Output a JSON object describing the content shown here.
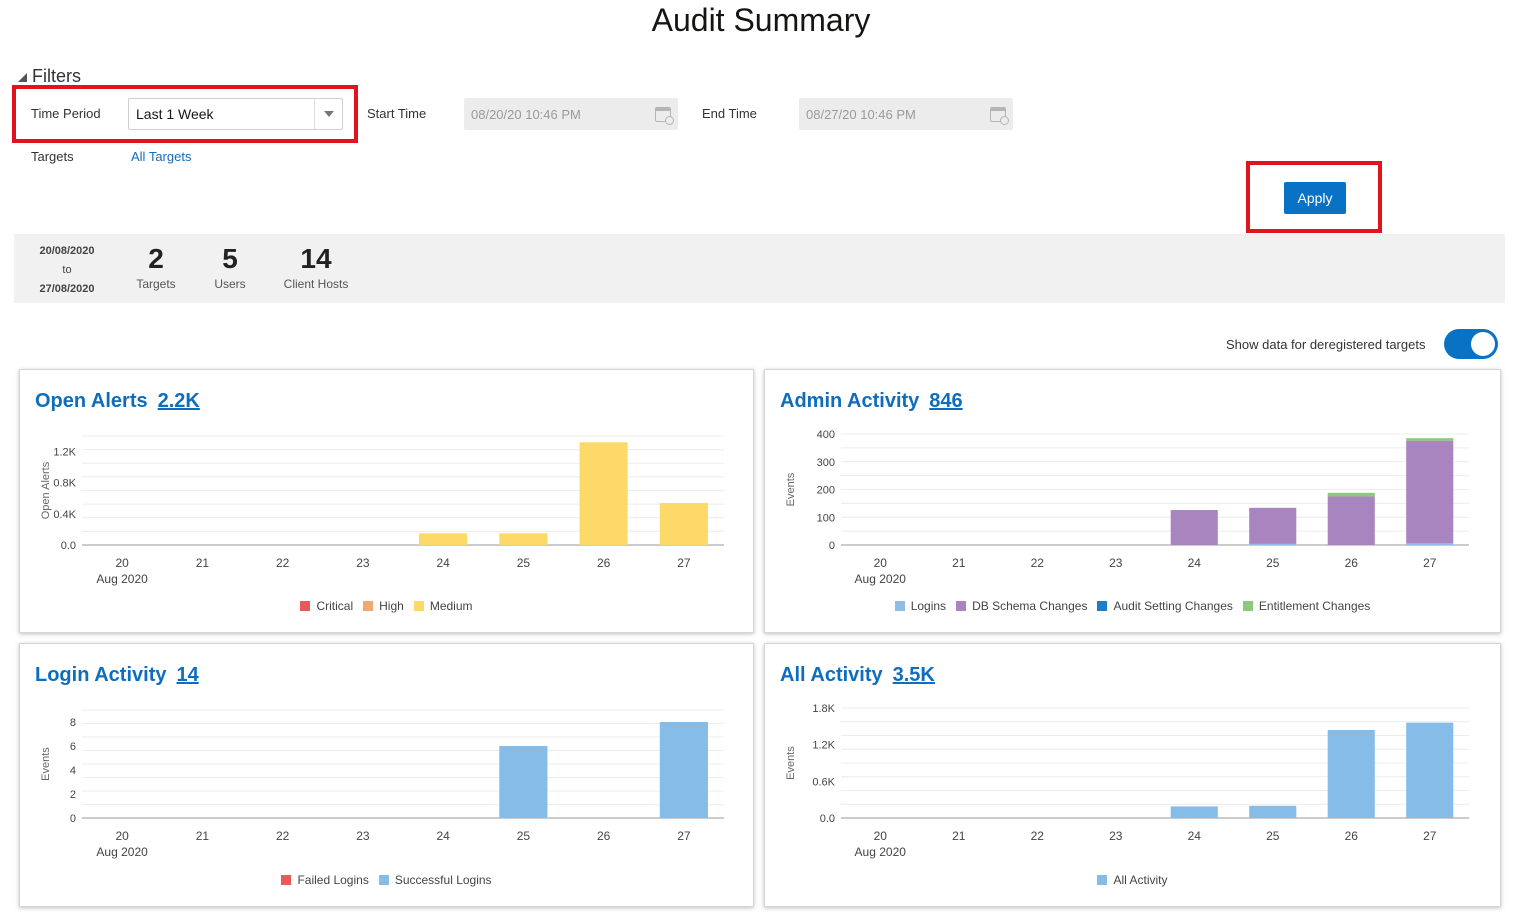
{
  "page_title": "Audit Summary",
  "filters": {
    "toggle_label": "Filters",
    "time_period_label": "Time Period",
    "time_period_value": "Last 1 Week",
    "start_time_label": "Start Time",
    "start_time_value": "08/20/20 10:46 PM",
    "end_time_label": "End Time",
    "end_time_value": "08/27/20 10:46 PM",
    "targets_label": "Targets",
    "targets_value": "All Targets",
    "apply_label": "Apply"
  },
  "summary": {
    "date_from": "20/08/2020",
    "date_to_word": "to",
    "date_to": "27/08/2020",
    "stats": [
      {
        "value": "2",
        "caption": "Targets"
      },
      {
        "value": "5",
        "caption": "Users"
      },
      {
        "value": "14",
        "caption": "Client Hosts"
      }
    ]
  },
  "deregistered_toggle": {
    "label": "Show data for deregistered targets",
    "on": true
  },
  "colors": {
    "accent": "#0a72c5",
    "link": "#0f6dbd",
    "highlight": "#e0131f"
  },
  "cards": {
    "open_alerts": {
      "title": "Open Alerts",
      "count": "2.2K"
    },
    "admin_activity": {
      "title": "Admin Activity",
      "count": "846"
    },
    "login_activity": {
      "title": "Login Activity",
      "count": "14"
    },
    "all_activity": {
      "title": "All Activity",
      "count": "3.5K"
    }
  },
  "chart_data": [
    {
      "id": "open_alerts",
      "type": "bar",
      "stacked": true,
      "categories": [
        "20",
        "21",
        "22",
        "23",
        "24",
        "25",
        "26",
        "27"
      ],
      "category_sublabel": "Aug 2020",
      "ylabel": "Open Alerts",
      "ylim": [
        0,
        1400
      ],
      "yticks": [
        0,
        400,
        800,
        1200
      ],
      "ytick_labels": [
        "0.0",
        "0.4K",
        "0.8K",
        "1.2K"
      ],
      "series": [
        {
          "name": "Critical",
          "color": "#e85a5a",
          "values": [
            0,
            0,
            0,
            0,
            0,
            0,
            0,
            0
          ]
        },
        {
          "name": "High",
          "color": "#f2a971",
          "values": [
            0,
            0,
            0,
            0,
            0,
            0,
            0,
            0
          ]
        },
        {
          "name": "Medium",
          "color": "#fdd96a",
          "values": [
            0,
            0,
            0,
            0,
            150,
            150,
            1320,
            540
          ]
        }
      ]
    },
    {
      "id": "admin_activity",
      "type": "bar",
      "stacked": true,
      "categories": [
        "20",
        "21",
        "22",
        "23",
        "24",
        "25",
        "26",
        "27"
      ],
      "category_sublabel": "Aug 2020",
      "ylabel": "Events",
      "ylim": [
        0,
        400
      ],
      "yticks": [
        0,
        100,
        200,
        300,
        400
      ],
      "ytick_labels": [
        "0",
        "100",
        "200",
        "300",
        "400"
      ],
      "series": [
        {
          "name": "Logins",
          "color": "#8fbde6",
          "values": [
            0,
            0,
            0,
            0,
            0,
            4,
            0,
            6
          ]
        },
        {
          "name": "DB Schema Changes",
          "color": "#a985bf",
          "values": [
            0,
            0,
            0,
            0,
            126,
            130,
            175,
            370
          ]
        },
        {
          "name": "Audit Setting Changes",
          "color": "#1f7dc8",
          "values": [
            0,
            0,
            0,
            0,
            0,
            0,
            0,
            0
          ]
        },
        {
          "name": "Entitlement Changes",
          "color": "#8cc97a",
          "values": [
            0,
            0,
            0,
            0,
            0,
            0,
            13,
            9
          ]
        }
      ]
    },
    {
      "id": "login_activity",
      "type": "bar",
      "stacked": true,
      "categories": [
        "20",
        "21",
        "22",
        "23",
        "24",
        "25",
        "26",
        "27"
      ],
      "category_sublabel": "Aug 2020",
      "ylabel": "Events",
      "ylim": [
        0,
        9
      ],
      "yticks": [
        0,
        2,
        4,
        6,
        8
      ],
      "ytick_labels": [
        "0",
        "2",
        "4",
        "6",
        "8"
      ],
      "series": [
        {
          "name": "Failed Logins",
          "color": "#e85a5a",
          "values": [
            0,
            0,
            0,
            0,
            0,
            0,
            0,
            0
          ]
        },
        {
          "name": "Successful Logins",
          "color": "#85bde8",
          "values": [
            0,
            0,
            0,
            0,
            0,
            6,
            0,
            8
          ]
        }
      ]
    },
    {
      "id": "all_activity",
      "type": "bar",
      "stacked": true,
      "categories": [
        "20",
        "21",
        "22",
        "23",
        "24",
        "25",
        "26",
        "27"
      ],
      "category_sublabel": "Aug 2020",
      "ylabel": "Events",
      "ylim": [
        0,
        1800
      ],
      "yticks": [
        0,
        600,
        1200,
        1800
      ],
      "ytick_labels": [
        "0.0",
        "0.6K",
        "1.2K",
        "1.8K"
      ],
      "series": [
        {
          "name": "All Activity",
          "color": "#85bde8",
          "values": [
            0,
            0,
            0,
            0,
            190,
            200,
            1440,
            1560
          ]
        }
      ]
    }
  ]
}
